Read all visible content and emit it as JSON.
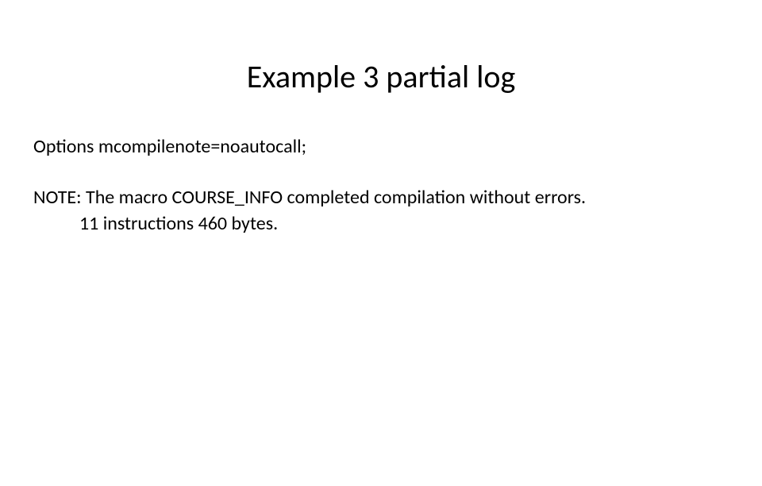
{
  "slide": {
    "title": "Example 3 partial log",
    "options_line": "Options mcompilenote=noautocall;",
    "note_line": "NOTE: The macro COURSE_INFO completed compilation without errors.",
    "detail_line": "11 instructions 460 bytes."
  }
}
